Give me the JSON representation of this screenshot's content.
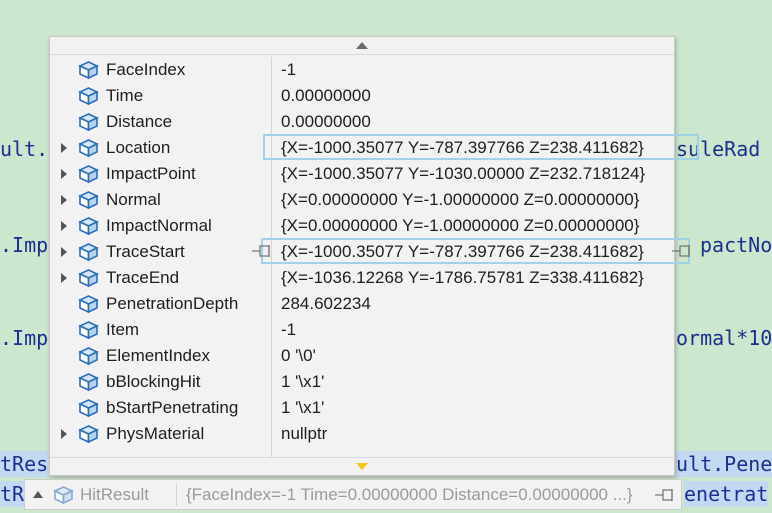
{
  "background_code": [
    {
      "text": "ult.",
      "line": "a"
    },
    {
      "text": "suleRad",
      "line": "b"
    },
    {
      "text": ".Imp",
      "line": "c"
    },
    {
      "text": "pactNo",
      "line": "d"
    },
    {
      "text": ".Imp",
      "line": "e"
    },
    {
      "text": "ormal*10",
      "line": "f"
    },
    {
      "text": "tRes",
      "line": "g"
    },
    {
      "text": "ult.Pene",
      "line": "h"
    },
    {
      "text": "tR",
      "line": "i"
    },
    {
      "text": "enetrat",
      "line": "j"
    }
  ],
  "colors": {
    "editor_background": "#cde7cf",
    "code_text": "#1b2f8f",
    "value_highlight_border": "#9fd2e8",
    "popup_background": "#f2f2f2",
    "field_icon": "#2a6eb8"
  },
  "watch": {
    "rows": [
      {
        "name": "FaceIndex",
        "value": "-1",
        "expandable": false,
        "icon": "field-icon"
      },
      {
        "name": "Time",
        "value": "0.00000000",
        "expandable": false,
        "icon": "field-icon"
      },
      {
        "name": "Distance",
        "value": "0.00000000",
        "expandable": false,
        "icon": "field-icon"
      },
      {
        "name": "Location",
        "value": "{X=-1000.35077 Y=-787.397766 Z=238.411682}",
        "expandable": true,
        "icon": "field-icon",
        "highlighted": true
      },
      {
        "name": "ImpactPoint",
        "value": "{X=-1000.35077 Y=-1030.00000 Z=232.718124}",
        "expandable": true,
        "icon": "field-icon"
      },
      {
        "name": "Normal",
        "value": "{X=0.00000000 Y=-1.00000000 Z=0.00000000}",
        "expandable": true,
        "icon": "field-icon"
      },
      {
        "name": "ImpactNormal",
        "value": "{X=0.00000000 Y=-1.00000000 Z=0.00000000}",
        "expandable": true,
        "icon": "field-icon"
      },
      {
        "name": "TraceStart",
        "value": "{X=-1000.35077 Y=-787.397766 Z=238.411682}",
        "expandable": true,
        "icon": "field-icon",
        "highlighted": true,
        "pinned": true
      },
      {
        "name": "TraceEnd",
        "value": "{X=-1036.12268 Y=-1786.75781 Z=338.411682}",
        "expandable": true,
        "icon": "field-icon"
      },
      {
        "name": "PenetrationDepth",
        "value": "284.602234",
        "expandable": false,
        "icon": "field-icon"
      },
      {
        "name": "Item",
        "value": "-1",
        "expandable": false,
        "icon": "field-icon"
      },
      {
        "name": "ElementIndex",
        "value": "0 '\\0'",
        "expandable": false,
        "icon": "field-icon"
      },
      {
        "name": "bBlockingHit",
        "value": "1 '\\x1'",
        "expandable": false,
        "icon": "field-icon"
      },
      {
        "name": "bStartPenetrating",
        "value": "1 '\\x1'",
        "expandable": false,
        "icon": "field-icon"
      },
      {
        "name": "PhysMaterial",
        "value": "nullptr",
        "expandable": true,
        "icon": "field-icon"
      }
    ]
  },
  "datatip": {
    "name": "HitResult",
    "value": "{FaceIndex=-1 Time=0.00000000 Distance=0.00000000 ...}",
    "icon": "field-icon",
    "pin_icon": "pin-icon"
  }
}
